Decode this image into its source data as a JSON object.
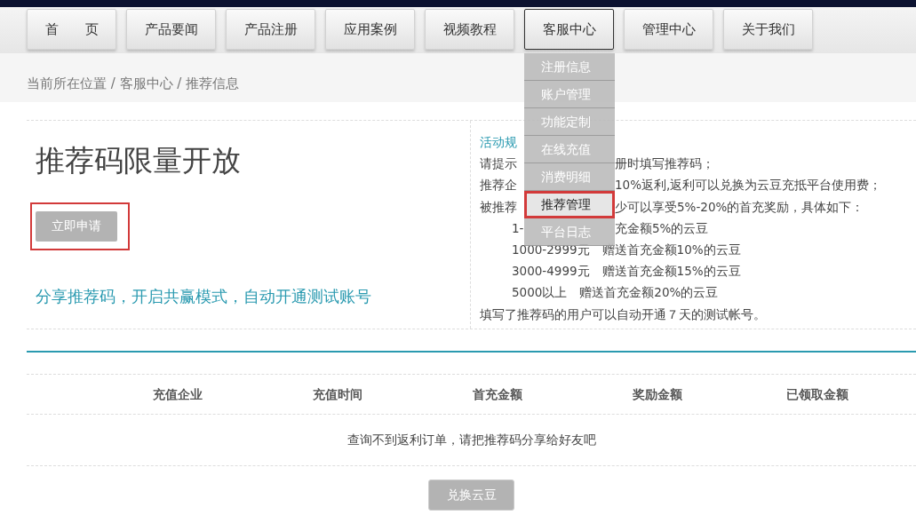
{
  "nav": [
    {
      "label": "首　　页",
      "selected": false
    },
    {
      "label": "产品要闻",
      "selected": false
    },
    {
      "label": "产品注册",
      "selected": false
    },
    {
      "label": "应用案例",
      "selected": false
    },
    {
      "label": "视频教程",
      "selected": false
    },
    {
      "label": "客服中心",
      "selected": true
    },
    {
      "label": "管理中心",
      "selected": false
    },
    {
      "label": "关于我们",
      "selected": false
    }
  ],
  "dropdown": [
    {
      "label": "注册信息",
      "selected": false,
      "annotated": false
    },
    {
      "label": "账户管理",
      "selected": false,
      "annotated": false
    },
    {
      "label": "功能定制",
      "selected": false,
      "annotated": false
    },
    {
      "label": "在线充值",
      "selected": false,
      "annotated": false
    },
    {
      "label": "消费明细",
      "selected": false,
      "annotated": false
    },
    {
      "label": "推荐管理",
      "selected": true,
      "annotated": true
    },
    {
      "label": "平台日志",
      "selected": false,
      "annotated": false
    }
  ],
  "breadcrumb": "当前所在位置 / 客服中心 / 推荐信息",
  "promo": {
    "title": "推荐码限量开放",
    "button": {
      "label": "立即申请",
      "annotated": true
    },
    "slogan": "分享推荐码，开启共赢模式，自动开通测试账号"
  },
  "rules": {
    "heading": "活动规",
    "lines": [
      {
        "kind": "split",
        "indented": false,
        "left": "请提示",
        "right": "册时填写推荐码；"
      },
      {
        "kind": "split",
        "indented": false,
        "left": "推荐企",
        "right": "10%返利,返利可以兑换为云豆充抵平台使用费；"
      },
      {
        "kind": "split",
        "indented": false,
        "left": "被推荐",
        "right": "少可以享受5%-20%的首充奖励，具体如下："
      },
      {
        "kind": "split",
        "indented": true,
        "left": "1-",
        "right": "充金额5%的云豆"
      },
      {
        "kind": "full",
        "indented": true,
        "text": "1000-2999元　赠送首充金额10%的云豆"
      },
      {
        "kind": "full",
        "indented": true,
        "text": "3000-4999元　赠送首充金额15%的云豆"
      },
      {
        "kind": "full",
        "indented": true,
        "text": "5000以上　赠送首充金额20%的云豆"
      },
      {
        "kind": "full",
        "indented": false,
        "text": "填写了推荐码的用户可以自动开通７天的测试帐号。"
      }
    ]
  },
  "table": {
    "columns": [
      "充值企业",
      "充值时间",
      "首充金额",
      "奖励金额",
      "已领取金额"
    ],
    "empty_message": "查询不到返利订单，请把推荐码分享给好友吧"
  },
  "exchange_button": "兑换云豆"
}
